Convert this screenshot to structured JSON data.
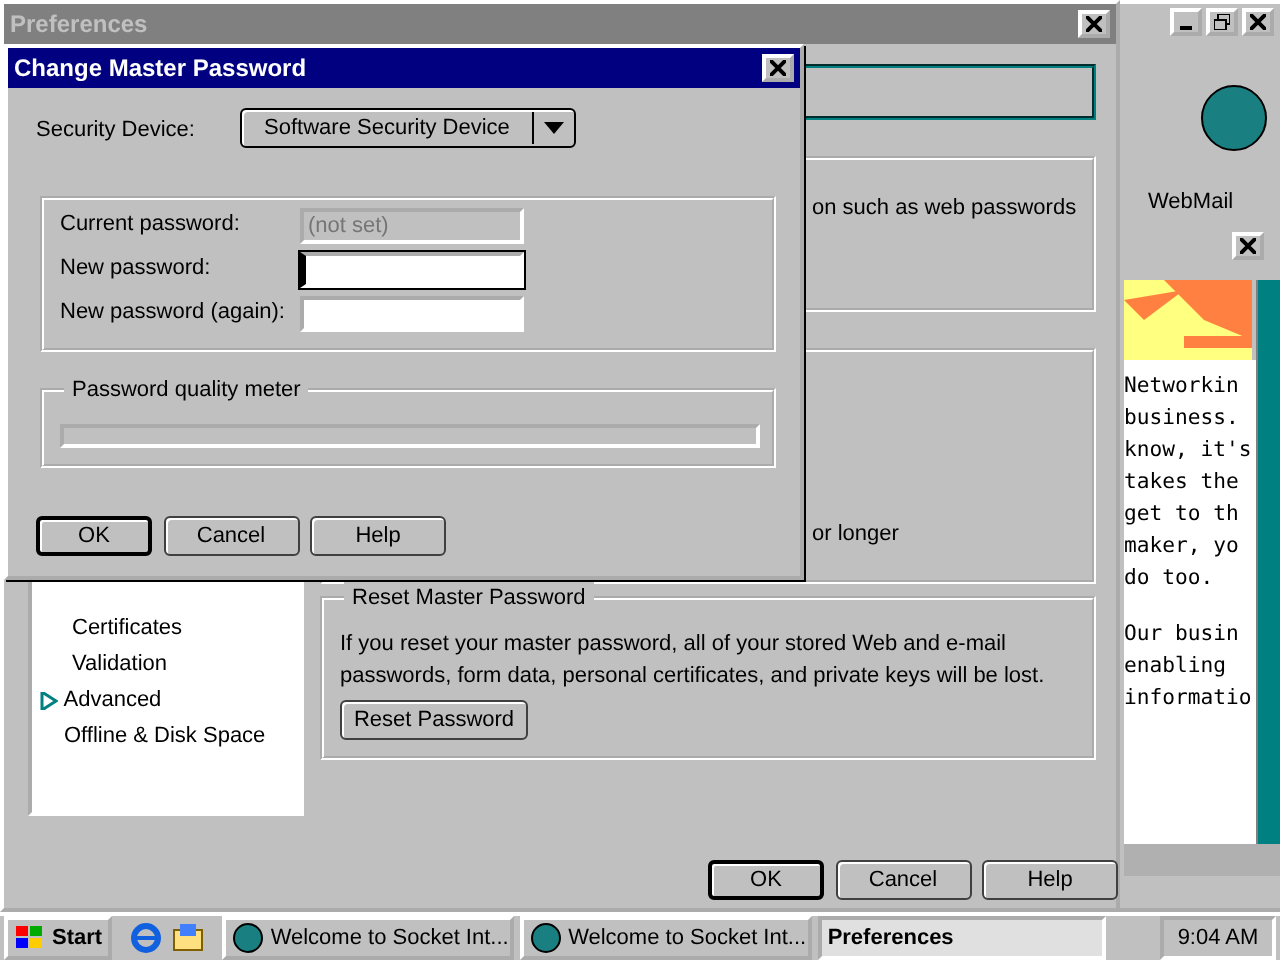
{
  "preferences": {
    "title": "Preferences",
    "tree": [
      {
        "children": [
          {
            "label": "Certificates"
          },
          {
            "label": "Validation"
          }
        ]
      },
      {
        "label": "Advanced",
        "expanded": false
      },
      {
        "label": "Offline & Disk Space"
      }
    ],
    "fragments": [
      "on such as web passwords",
      "or longer"
    ],
    "reset_group": {
      "title": "Reset Master Password",
      "text": "If you reset your master password, all of your stored Web and e-mail passwords, form data, personal certificates, and private keys will be lost.",
      "button": "Reset Password"
    },
    "buttons": [
      {
        "label": "OK",
        "default": true
      },
      {
        "label": "Cancel",
        "default": false
      },
      {
        "label": "Help",
        "default": false
      }
    ]
  },
  "dialog": {
    "title": "Change Master Password",
    "security_device_label": "Security Device:",
    "security_device": "Software Security Device",
    "fields": [
      {
        "label": "Current password:",
        "placeholder": "(not set)",
        "disabled": true,
        "focused": false
      },
      {
        "label": "New password:",
        "disabled": false,
        "focused": true
      },
      {
        "label": "New password (again):",
        "disabled": false,
        "focused": false
      }
    ],
    "meter": {
      "title": "Password quality meter",
      "level": 0
    },
    "buttons": [
      {
        "label": "OK",
        "default": true
      },
      {
        "label": "Cancel",
        "default": false
      },
      {
        "label": "Help",
        "default": false
      }
    ]
  },
  "browser": {
    "toolbar_link": "WebMail",
    "paragraphs": [
      [
        "Networkin",
        "business.",
        "know, it's",
        "takes the",
        "get to th",
        "maker, yo",
        "do too."
      ],
      [
        "Our busin",
        "enabling",
        "informatio"
      ]
    ]
  },
  "taskbar": {
    "start": "Start",
    "tasks": [
      {
        "label": "Welcome to Socket Int...",
        "selected": false
      },
      {
        "label": "Welcome to Socket Int...",
        "selected": false
      },
      {
        "label": "Preferences",
        "selected": true
      }
    ],
    "clock": "9:04 AM"
  }
}
